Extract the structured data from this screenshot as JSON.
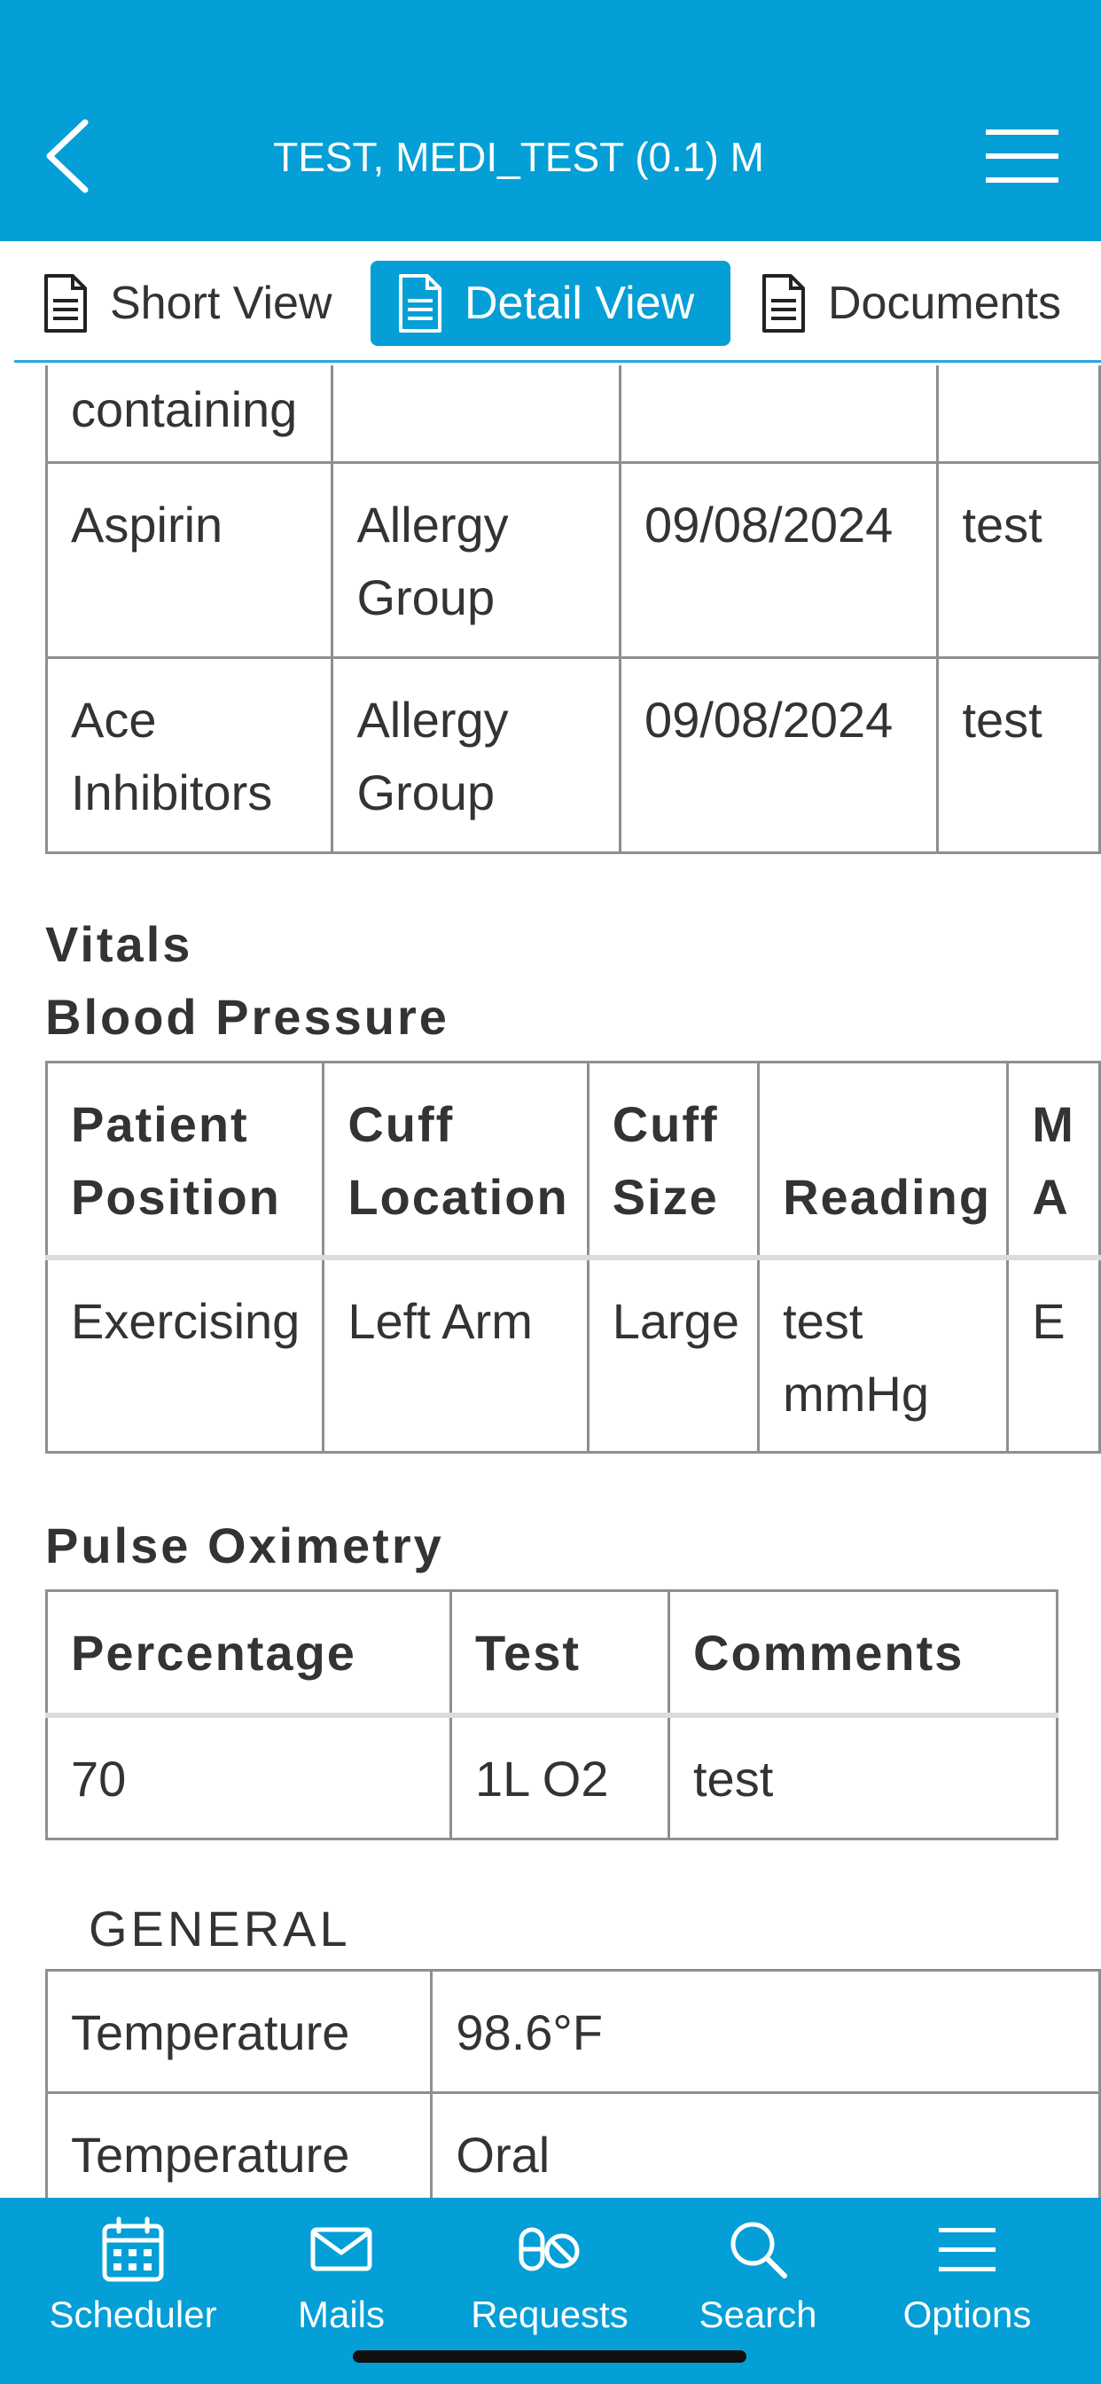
{
  "header": {
    "title": "TEST, MEDI_TEST (0.1) M",
    "back_icon": "chevron-left-icon",
    "menu_icon": "hamburger-menu-icon"
  },
  "tabs": [
    {
      "label": "Short View",
      "icon": "document-icon",
      "active": false
    },
    {
      "label": "Detail View",
      "icon": "document-icon",
      "active": true
    },
    {
      "label": "Documents",
      "icon": "document-icon",
      "active": false
    }
  ],
  "allergies": {
    "rows": [
      [
        "containing",
        "",
        "",
        ""
      ],
      [
        "Aspirin",
        "Allergy Group",
        "09/08/2024",
        "test"
      ],
      [
        "Ace Inhibitors",
        "Allergy Group",
        "09/08/2024",
        "test"
      ]
    ]
  },
  "vitals": {
    "title": "Vitals",
    "blood_pressure": {
      "title": "Blood Pressure",
      "headers": [
        "Patient Position",
        "Cuff Location",
        "Cuff Size",
        "Reading",
        "M A"
      ],
      "rows": [
        [
          "Exercising",
          "Left Arm",
          "Large",
          "test mmHg",
          "E"
        ]
      ]
    },
    "pulse_oximetry": {
      "title": "Pulse Oximetry",
      "headers": [
        "Percentage",
        "Test",
        "Comments"
      ],
      "rows": [
        [
          "70",
          "1L O2",
          "test"
        ]
      ]
    },
    "general": {
      "title": "GENERAL",
      "rows": [
        [
          "Temperature",
          "98.6°F"
        ],
        [
          "Temperature",
          "Oral"
        ]
      ]
    }
  },
  "bottom_nav": [
    {
      "label": "Scheduler",
      "icon": "calendar-icon"
    },
    {
      "label": "Mails",
      "icon": "mail-icon"
    },
    {
      "label": "Requests",
      "icon": "pills-icon"
    },
    {
      "label": "Search",
      "icon": "search-icon"
    },
    {
      "label": "Options",
      "icon": "options-menu-icon"
    }
  ],
  "colors": {
    "primary": "#039fd6",
    "border": "#8f8f8f",
    "text": "#333333"
  }
}
